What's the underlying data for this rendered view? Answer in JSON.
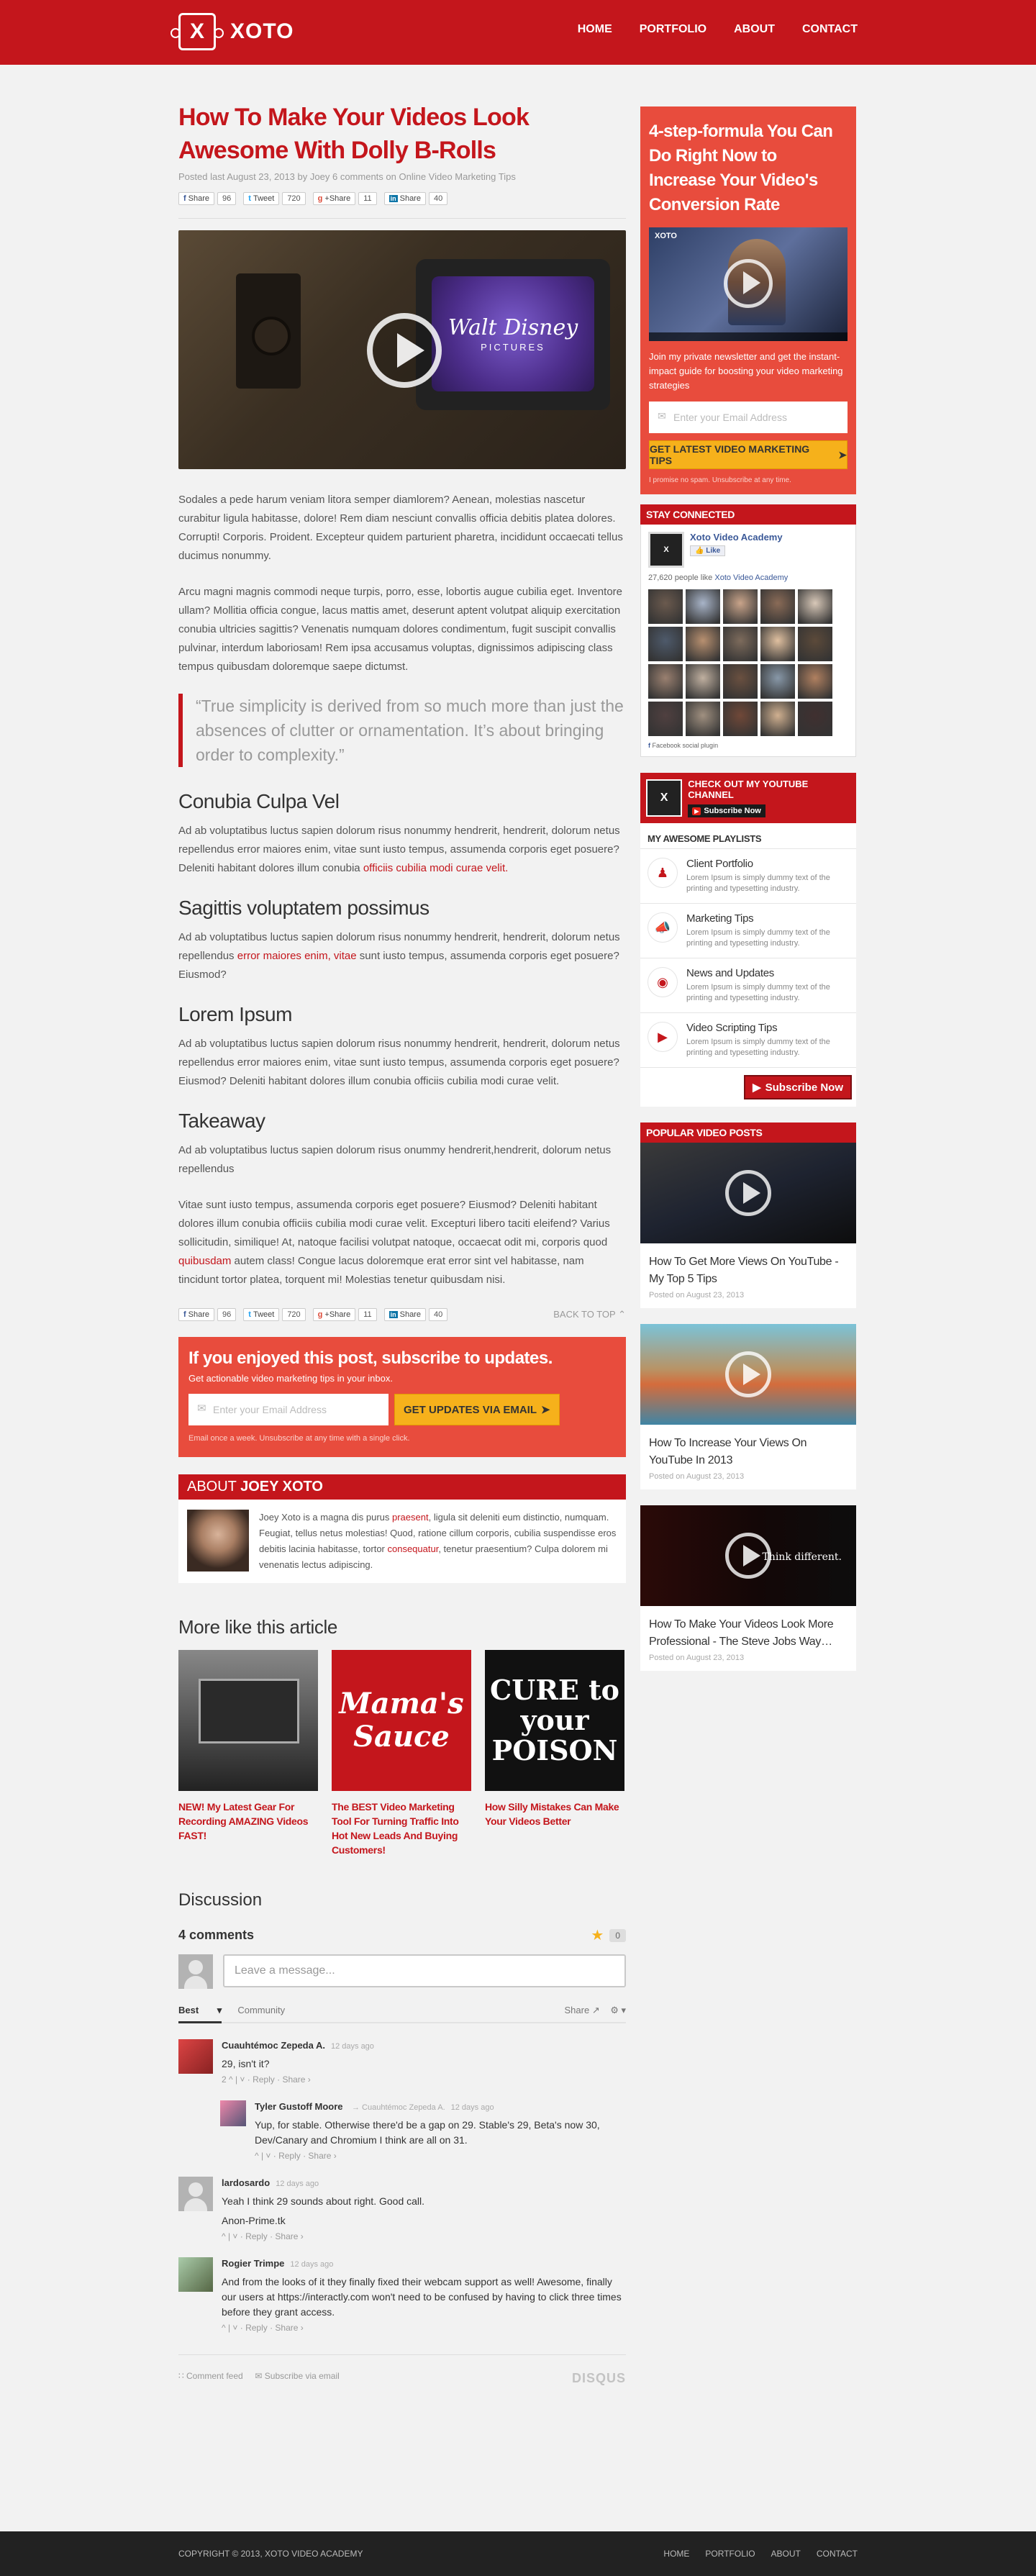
{
  "header": {
    "logo": "XOTO",
    "nav": [
      "HOME",
      "PORTFOLIO",
      "ABOUT",
      "CONTACT"
    ]
  },
  "post": {
    "title": "How To Make Your Videos Look Awesome With Dolly B-Rolls",
    "meta_prefix": "Posted last ",
    "date": "August 23, 2013",
    "by": " by ",
    "author": "Joey",
    "comments": "6 comments",
    "on": " on ",
    "category": "Online Video Marketing Tips",
    "shares": {
      "fb": "Share",
      "fb_count": "96",
      "tw": "Tweet",
      "tw_count": "720",
      "gp": "+Share",
      "gp_count": "11",
      "li": "Share",
      "li_count": "40"
    },
    "video": {
      "brand": "Walt Disney",
      "brand2": "PICTURES"
    },
    "p1": "Sodales a pede harum veniam litora semper diamlorem? Aenean, molestias nascetur curabitur ligula habitasse, dolore! Rem diam nesciunt convallis officia debitis platea dolores. Corrupti! Corporis. Proident. Excepteur quidem parturient pharetra, incididunt occaecati tellus ducimus nonummy.",
    "p2": "Arcu magni magnis commodi neque turpis, porro, esse, lobortis augue cubilia eget. Inventore ullam? Mollitia officia congue, lacus mattis amet, deserunt aptent volutpat aliquip exercitation conubia ultricies sagittis? Venenatis numquam dolores condimentum, fugit suscipit convallis pulvinar, interdum laboriosam! Rem ipsa accusamus voluptas, dignissimos adipiscing class tempus quibusdam doloremque saepe dictumst.",
    "quote": "“True simplicity is derived from so much more than just the absences of clutter or ornamentation. It’s about bringing order to complexity.”",
    "h1": "Conubia Culpa Vel",
    "s1a": "Ad ab voluptatibus luctus sapien dolorum risus nonummy hendrerit, hendrerit, dolorum netus repellendus error maiores enim, vitae sunt iusto tempus, assumenda corporis eget posuere? Deleniti habitant dolores illum conubia ",
    "s1link": "officiis cubilia modi curae velit.",
    "h2": "Sagittis voluptatem possimus",
    "s2a": "Ad ab voluptatibus luctus sapien dolorum risus nonummy hendrerit, hendrerit, dolorum netus repellendus ",
    "s2link": "error maiores enim, vitae",
    "s2b": " sunt iusto tempus, assumenda corporis eget posuere? Eiusmod?",
    "h3": "Lorem Ipsum",
    "s3": "Ad ab voluptatibus luctus sapien dolorum risus nonummy hendrerit, hendrerit, dolorum netus repellendus error maiores enim, vitae sunt iusto tempus, assumenda corporis eget posuere? Eiusmod? Deleniti habitant dolores illum conubia officiis cubilia modi curae velit.",
    "h4": "Takeaway",
    "s4": "Ad ab voluptatibus luctus sapien dolorum risus onummy hendrerit,hendrerit, dolorum netus repellendus",
    "s5a": "Vitae sunt iusto tempus, assumenda corporis eget posuere? Eiusmod? Deleniti habitant dolores illum conubia officiis cubilia modi curae velit. Excepturi libero taciti eleifend?  Varius sollicitudin, similique! At, natoque facilisi volutpat natoque, occaecat odit mi, corporis quod ",
    "s5link": "quibusdam",
    "s5b": " autem class! Congue lacus doloremque erat error sint vel habitasse, nam tincidunt tortor platea, torquent mi! Molestias tenetur quibusdam nisi.",
    "back_top": "BACK TO TOP"
  },
  "subscribe": {
    "title": "If you enjoyed this post, subscribe to updates.",
    "subtitle": "Get actionable video marketing tips in your inbox.",
    "placeholder": "Enter your Email Address",
    "button": "GET UPDATES VIA EMAIL",
    "note": "Email once a week. Unsubscribe at any time with a single click."
  },
  "about": {
    "title_pre": "ABOUT ",
    "title_name": "JOEY XOTO",
    "t1": "Joey Xoto is a magna dis purus ",
    "l1": "praesent",
    "t2": ", ligula sit deleniti eum distinctio, numquam. Feugiat, tellus netus molestias! Quod, ratione cillum corporis, cubilia suspendisse eros debitis lacinia habitasse, tortor ",
    "l2": "consequatur",
    "t3": ", tenetur praesentium? Culpa dolorem mi venenatis lectus adipiscing."
  },
  "more": {
    "title": "More like this article",
    "items": [
      {
        "title": "NEW! My Latest Gear For Recording AMAZING Videos FAST!"
      },
      {
        "title": "The BEST Video Marketing Tool For Turning Traffic Into Hot New Leads And Buying Customers!",
        "img_text": "Mama's Sauce"
      },
      {
        "title": "How Silly Mistakes Can Make Your Videos Better",
        "img_text": "CURE to your POISON"
      }
    ]
  },
  "discussion": {
    "title": "Discussion",
    "count": "4 comments",
    "fav_count": "0",
    "placeholder": "Leave a message...",
    "sort_best": "Best",
    "sort_community": "Community",
    "share": "Share",
    "comments": [
      {
        "name": "Cuauhtémoc Zepeda A.",
        "time": "12 days ago",
        "text": "29, isn't it?",
        "actions": "2 ^ | ˅ · Reply · Share ›"
      },
      {
        "name": "Tyler Gustoff Moore",
        "reply_to": "→ Cuauhtémoc Zepeda A.",
        "time": "12 days ago",
        "text": "Yup, for stable. Otherwise there'd be a gap on 29. Stable's 29, Beta's now 30, Dev/Canary and Chromium I think are all on 31.",
        "actions": "^ | ˅ · Reply · Share ›"
      },
      {
        "name": "lardosardo",
        "time": "12 days ago",
        "text": "Yeah I think 29 sounds about right. Good call.",
        "extra": "Anon-Prime.tk",
        "actions": "^ | ˅ · Reply · Share ›"
      },
      {
        "name": "Rogier Trimpe",
        "time": "12 days ago",
        "text": "And from the looks of it they finally fixed their webcam support as well! Awesome, finally our users at https://interactly.com won't need to be confused by having to click three times before they grant access.",
        "actions": "^ | ˅ · Reply · Share ›"
      }
    ],
    "footer_feed": "Comment feed",
    "footer_email": "Subscribe via email",
    "footer_brand": "DISQUS"
  },
  "sidebar": {
    "optin": {
      "title": "4-step-formula You Can Do Right Now to Increase Your Video's Conversion Rate",
      "video_logo": "XOTO",
      "desc": "Join my private newsletter and get the instant-impact guide for boosting your video marketing  strategies",
      "placeholder": "Enter your Email Address",
      "button": "GET LATEST VIDEO MARKETING TIPS",
      "note": "I promise no spam. Unsubscribe at any time."
    },
    "stay": {
      "title": "STAY CONNECTED",
      "page": "Xoto Video Academy",
      "like": "Like",
      "people": "27,620 people like ",
      "people_link": "Xoto Video Academy",
      "plugin": "Facebook social plugin"
    },
    "youtube": {
      "title": "CHECK OUT MY YOUTUBE CHANNEL",
      "subscribe": "Subscribe Now",
      "playlists_title": "MY AWESOME PLAYLISTS",
      "playlists": [
        {
          "name": "Client Portfolio",
          "desc": "Lorem Ipsum is simply dummy text of the printing and typesetting industry.",
          "icon": "users-icon"
        },
        {
          "name": "Marketing Tips",
          "desc": "Lorem Ipsum is simply dummy text of the printing and typesetting industry.",
          "icon": "megaphone-icon"
        },
        {
          "name": "News and Updates",
          "desc": "Lorem Ipsum is simply dummy text of the printing and typesetting industry.",
          "icon": "globe-icon"
        },
        {
          "name": "Video Scripting Tips",
          "desc": "Lorem Ipsum is simply dummy text of the printing and typesetting industry.",
          "icon": "play-icon"
        }
      ],
      "subscribe_now": "Subscribe Now"
    },
    "popular": {
      "title": "POPULAR VIDEO POSTS",
      "items": [
        {
          "title": "How To Get More Views On YouTube - My Top 5 Tips",
          "date": "Posted on August 23, 2013"
        },
        {
          "title": "How To Increase Your Views On YouTube In 2013",
          "date": "Posted on August 23, 2013"
        },
        {
          "title": "How To Make Your Videos Look More Professional - The Steve Jobs Way…",
          "date": "Posted on August 23, 2013",
          "img_text": "Think different."
        }
      ]
    }
  },
  "footer": {
    "copy": "COPYRIGHT © 2013, XOTO VIDEO ACADEMY",
    "nav": [
      "HOME",
      "PORTFOLIO",
      "ABOUT",
      "CONTACT"
    ]
  },
  "colors": {
    "brand": "#c4161c",
    "accent": "#e84c3d",
    "cta": "#f6b11b"
  }
}
